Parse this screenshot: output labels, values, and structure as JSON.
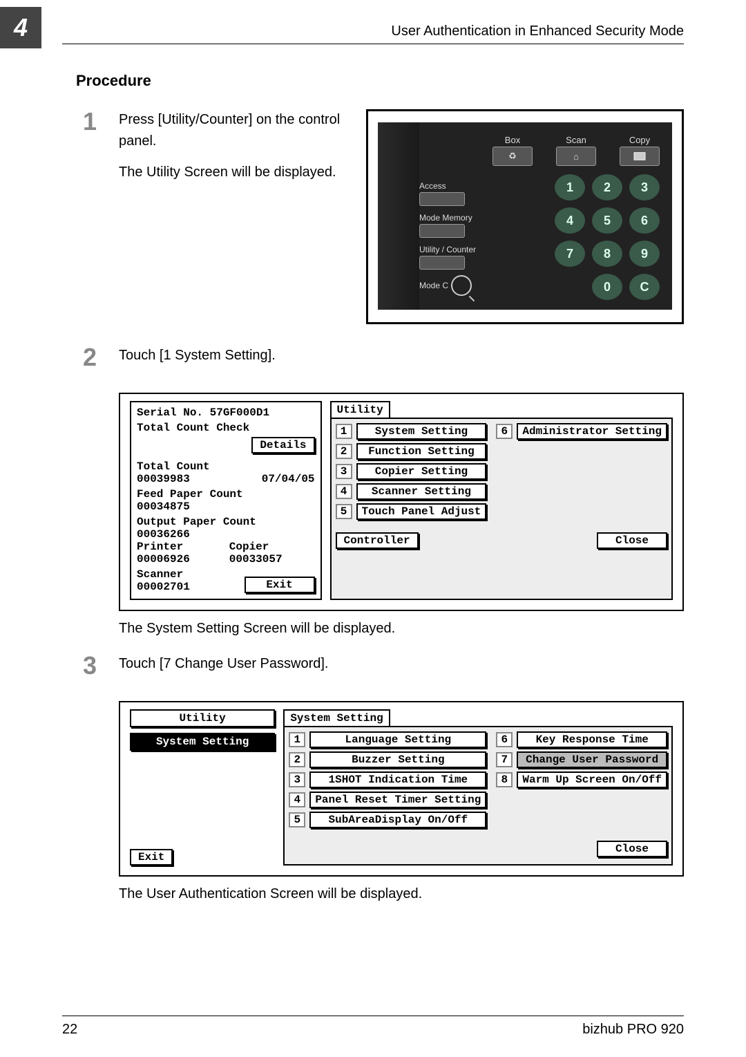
{
  "header_title": "User Authentication in Enhanced Security Mode",
  "chapter_num": "4",
  "procedure_heading": "Procedure",
  "steps": {
    "s1": {
      "num": "1",
      "p1": "Press [Utility/Counter] on the control panel.",
      "p2": "The Utility Screen will be displayed."
    },
    "s2": {
      "num": "2",
      "p1": "Touch [1 System Setting]."
    },
    "s2_post": "The System Setting Screen will be displayed.",
    "s3": {
      "num": "3",
      "p1": "Touch [7 Change User Password]."
    },
    "s3_post": "The User Authentication Screen will be displayed."
  },
  "panel": {
    "top": {
      "box": "Box",
      "scan": "Scan",
      "copy": "Copy"
    },
    "side": {
      "access": "Access",
      "mode_memory": "Mode Memory",
      "utility_counter": "Utility / Counter",
      "modec": "Mode C"
    },
    "keypad": [
      "1",
      "2",
      "3",
      "4",
      "5",
      "6",
      "7",
      "8",
      "9",
      "",
      "0",
      "C"
    ]
  },
  "screen1": {
    "serial_label": "Serial No.",
    "serial_no": "57GF000D1",
    "total_count_check": "Total Count Check",
    "details_btn": "Details",
    "total_count_lbl": "Total Count",
    "total_count_val": "00039983",
    "date": "07/04/05",
    "feed_lbl": "Feed Paper Count",
    "feed_val": "00034875",
    "output_lbl": "Output Paper Count",
    "output_val": "00036266",
    "printer_lbl": "Printer",
    "copier_lbl": "Copier",
    "printer_val": "00006926",
    "copier_val": "00033057",
    "scanner_lbl": "Scanner",
    "scanner_val": "00002701",
    "exit_btn": "Exit",
    "utility_title": "Utility",
    "items_left": [
      {
        "n": "1",
        "label": "System Setting"
      },
      {
        "n": "2",
        "label": "Function Setting"
      },
      {
        "n": "3",
        "label": "Copier Setting"
      },
      {
        "n": "4",
        "label": "Scanner Setting"
      },
      {
        "n": "5",
        "label": "Touch Panel Adjust"
      }
    ],
    "items_right": [
      {
        "n": "6",
        "label": "Administrator Setting"
      }
    ],
    "controller_btn": "Controller",
    "close_btn": "Close"
  },
  "screen2": {
    "nav_utility": "Utility",
    "nav_system": "System Setting",
    "exit_btn": "Exit",
    "title": "System Setting",
    "left": [
      {
        "n": "1",
        "label": "Language Setting"
      },
      {
        "n": "2",
        "label": "Buzzer Setting"
      },
      {
        "n": "3",
        "label": "1SHOT Indication Time"
      },
      {
        "n": "4",
        "label": "Panel Reset Timer Setting"
      },
      {
        "n": "5",
        "label": "SubAreaDisplay On/Off"
      }
    ],
    "right": [
      {
        "n": "6",
        "label": "Key Response Time"
      },
      {
        "n": "7",
        "label": "Change User Password"
      },
      {
        "n": "8",
        "label": "Warm Up Screen On/Off"
      }
    ],
    "close_btn": "Close"
  },
  "footer": {
    "page": "22",
    "product": "bizhub PRO 920"
  }
}
